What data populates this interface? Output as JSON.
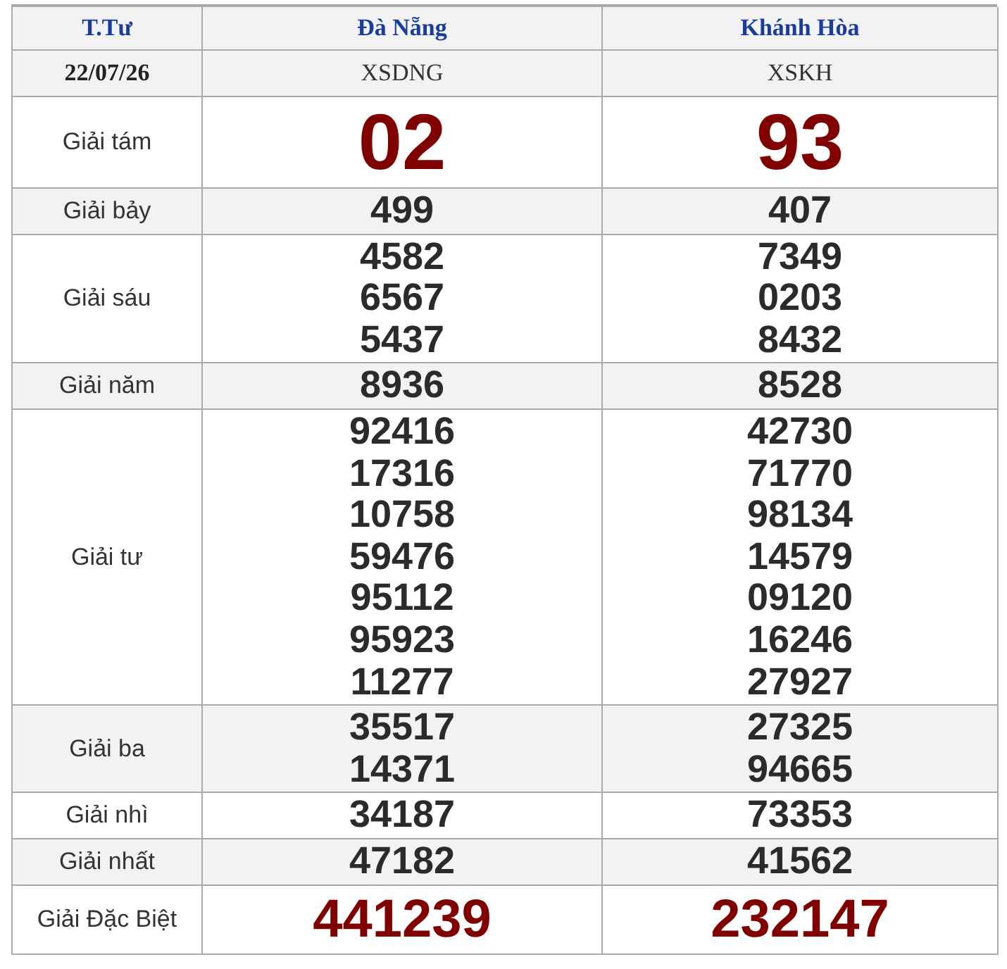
{
  "header": {
    "label": "T.Tư",
    "provinces": [
      "Đà Nẵng",
      "Khánh Hòa"
    ]
  },
  "date_row": {
    "date": "22/07/26",
    "codes": [
      "XSDNG",
      "XSKH"
    ]
  },
  "prizes": [
    {
      "name": "Giải tám",
      "kind": "large",
      "results": [
        [
          "02"
        ],
        [
          "93"
        ]
      ]
    },
    {
      "name": "Giải bảy",
      "kind": "normal",
      "results": [
        [
          "499"
        ],
        [
          "407"
        ]
      ]
    },
    {
      "name": "Giải sáu",
      "kind": "normal",
      "results": [
        [
          "4582",
          "6567",
          "5437"
        ],
        [
          "7349",
          "0203",
          "8432"
        ]
      ]
    },
    {
      "name": "Giải năm",
      "kind": "normal",
      "results": [
        [
          "8936"
        ],
        [
          "8528"
        ]
      ]
    },
    {
      "name": "Giải tư",
      "kind": "normal",
      "results": [
        [
          "92416",
          "17316",
          "10758",
          "59476",
          "95112",
          "95923",
          "11277"
        ],
        [
          "42730",
          "71770",
          "98134",
          "14579",
          "09120",
          "16246",
          "27927"
        ]
      ]
    },
    {
      "name": "Giải ba",
      "kind": "normal",
      "results": [
        [
          "35517",
          "14371"
        ],
        [
          "27325",
          "94665"
        ]
      ]
    },
    {
      "name": "Giải nhì",
      "kind": "normal",
      "results": [
        [
          "34187"
        ],
        [
          "73353"
        ]
      ]
    },
    {
      "name": "Giải nhất",
      "kind": "normal",
      "results": [
        [
          "47182"
        ],
        [
          "41562"
        ]
      ]
    },
    {
      "name": "Giải Đặc Biệt",
      "kind": "special",
      "results": [
        [
          "441239"
        ],
        [
          "232147"
        ]
      ]
    }
  ]
}
